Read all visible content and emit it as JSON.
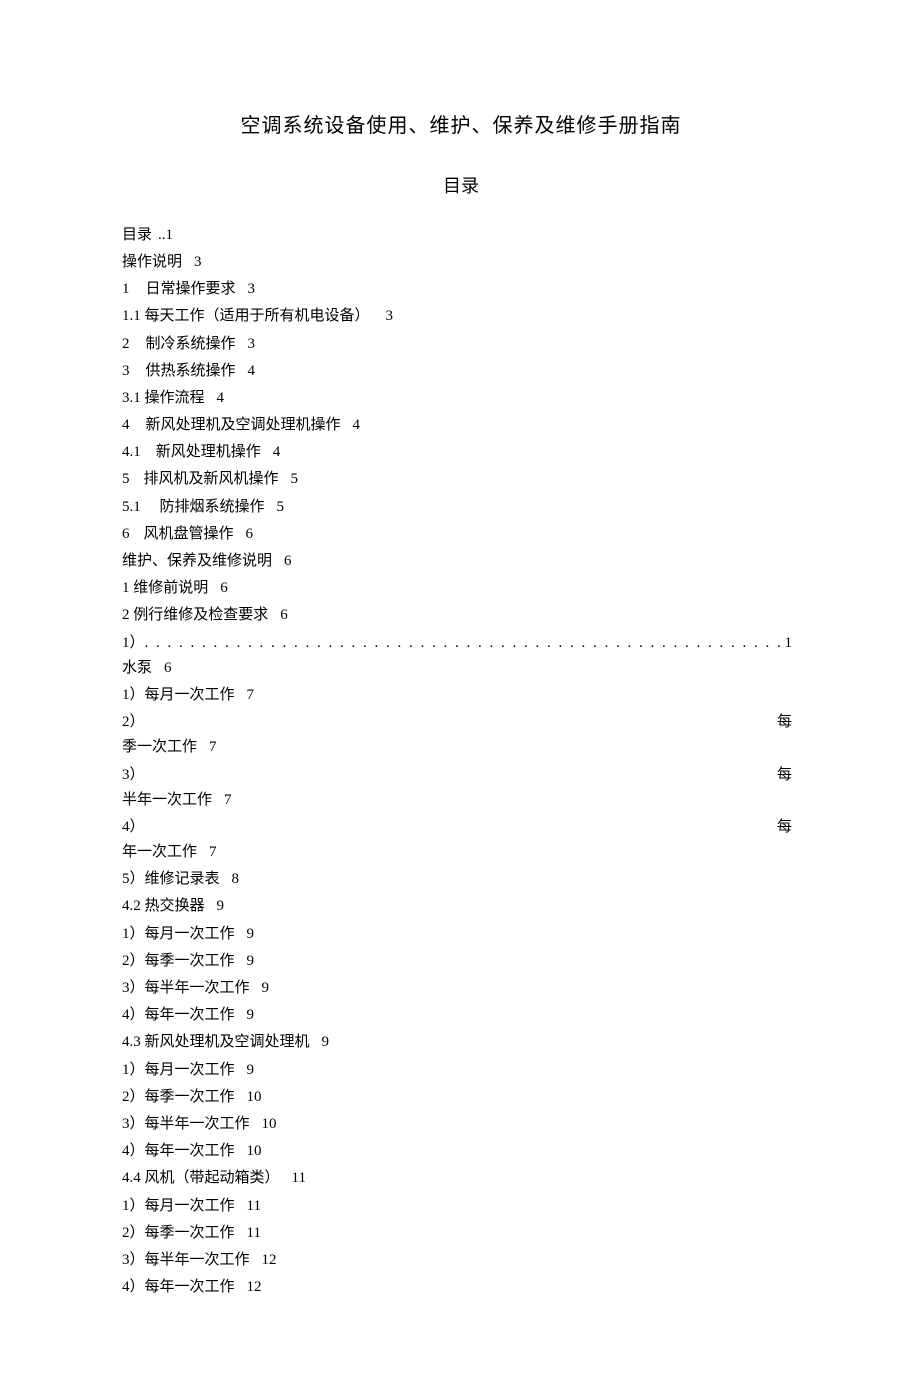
{
  "title": "空调系统设备使用、维护、保养及维修手册指南",
  "toc_heading": "目录",
  "dots": ". . . . . . . . . . . . . . . . . . . . . . . . . . . . . . . . . . . . . . . . . . . . . . . . . . . . . . . . . . . . . . . . . . . . . . . . . . . . . . . . . . . . . . . . . . . . . . . . . . . . . . . . . . . . . . . . . . . . . .",
  "entries": [
    {
      "indent": "l0",
      "text": "目录",
      "page": "..1",
      "gap": 6
    },
    {
      "indent": "l0",
      "text": "操作说明",
      "page": "3",
      "gap": 12
    },
    {
      "indent": "l1",
      "num": "1",
      "numgap": 16,
      "text": "日常操作要求",
      "page": "3",
      "gap": 12
    },
    {
      "indent": "l2",
      "text": "1.1 每天工作（适用于所有机电设备）",
      "page": "3",
      "gap": 16
    },
    {
      "indent": "l1",
      "num": "2",
      "numgap": 16,
      "text": "制冷系统操作",
      "page": "3",
      "gap": 12
    },
    {
      "indent": "l1",
      "num": "3",
      "numgap": 16,
      "text": "供热系统操作",
      "page": "4",
      "gap": 12
    },
    {
      "indent": "l2",
      "text": "3.1 操作流程",
      "page": "4",
      "gap": 12
    },
    {
      "indent": "l1",
      "num": "4",
      "numgap": 16,
      "text": "新风处理机及空调处理机操作",
      "page": "4",
      "gap": 12
    },
    {
      "indent": "l2",
      "text": "4.1　新风处理机操作",
      "page": "4",
      "gap": 12
    },
    {
      "indent": "l1",
      "num": "5",
      "numgap": 14,
      "text": "排风机及新风机操作",
      "page": "5",
      "gap": 12
    },
    {
      "indent": "l1",
      "text": "5.1　 防排烟系统操作",
      "page": "5",
      "gap": 12
    },
    {
      "indent": "l1",
      "num": "6",
      "numgap": 14,
      "text": "风机盘管操作",
      "page": "6",
      "gap": 12
    },
    {
      "indent": "l0",
      "text": "维护、保养及维修说明",
      "page": "6",
      "gap": 12
    },
    {
      "indent": "l1",
      "text": "1 维修前说明",
      "page": "6",
      "gap": 12
    },
    {
      "indent": "l1",
      "text": "2 例行维修及检查要求",
      "page": "6",
      "gap": 12
    },
    {
      "indent": "l3",
      "type": "dotted",
      "lead": "1）",
      "tail": "1"
    },
    {
      "indent": "l3",
      "type": "cont",
      "text": "水泵",
      "page": "6",
      "gap": 12
    },
    {
      "indent": "l3",
      "text": "1）每月一次工作",
      "page": "7",
      "gap": 12
    },
    {
      "indent": "l3",
      "type": "split",
      "left": "2）",
      "right": "每"
    },
    {
      "indent": "l3",
      "type": "cont",
      "text": "季一次工作",
      "page": "7",
      "gap": 12
    },
    {
      "indent": "l3",
      "type": "split",
      "left": "3）",
      "right": "每"
    },
    {
      "indent": "l3",
      "type": "cont",
      "text": "半年一次工作",
      "page": "7",
      "gap": 12
    },
    {
      "indent": "l3",
      "type": "split",
      "left": "4）",
      "right": "每"
    },
    {
      "indent": "l3",
      "type": "cont",
      "text": "年一次工作",
      "page": "7",
      "gap": 12
    },
    {
      "indent": "l3",
      "text": "5）维修记录表",
      "page": "8",
      "gap": 12
    },
    {
      "indent": "l3",
      "text": "4.2 热交换器",
      "page": "9",
      "gap": 12
    },
    {
      "indent": "l3",
      "text": "1）每月一次工作",
      "page": "9",
      "gap": 12
    },
    {
      "indent": "l3",
      "text": "2）每季一次工作",
      "page": "9",
      "gap": 12
    },
    {
      "indent": "l3",
      "text": "3）每半年一次工作",
      "page": "9",
      "gap": 12
    },
    {
      "indent": "l3",
      "text": "4）每年一次工作",
      "page": "9",
      "gap": 12
    },
    {
      "indent": "l3",
      "text": "4.3  新风处理机及空调处理机",
      "page": "9",
      "gap": 12
    },
    {
      "indent": "l3",
      "text": "1）每月一次工作",
      "page": "9",
      "gap": 12
    },
    {
      "indent": "l3",
      "text": "2）每季一次工作",
      "page": "10",
      "gap": 12
    },
    {
      "indent": "l3",
      "text": "3）每半年一次工作",
      "page": "10",
      "gap": 12
    },
    {
      "indent": "l3",
      "text": "4）每年一次工作",
      "page": "10",
      "gap": 12
    },
    {
      "indent": "l3",
      "text": "4.4  风机（带起动箱类）",
      "page": "11",
      "gap": 12
    },
    {
      "indent": "l3",
      "text": "1）每月一次工作",
      "page": "11",
      "gap": 12
    },
    {
      "indent": "l3",
      "text": "2）每季一次工作",
      "page": "11",
      "gap": 12
    },
    {
      "indent": "l3",
      "text": "3）每半年一次工作",
      "page": "12",
      "gap": 12
    },
    {
      "indent": "l3",
      "text": "4）每年一次工作",
      "page": "12",
      "gap": 12
    }
  ]
}
